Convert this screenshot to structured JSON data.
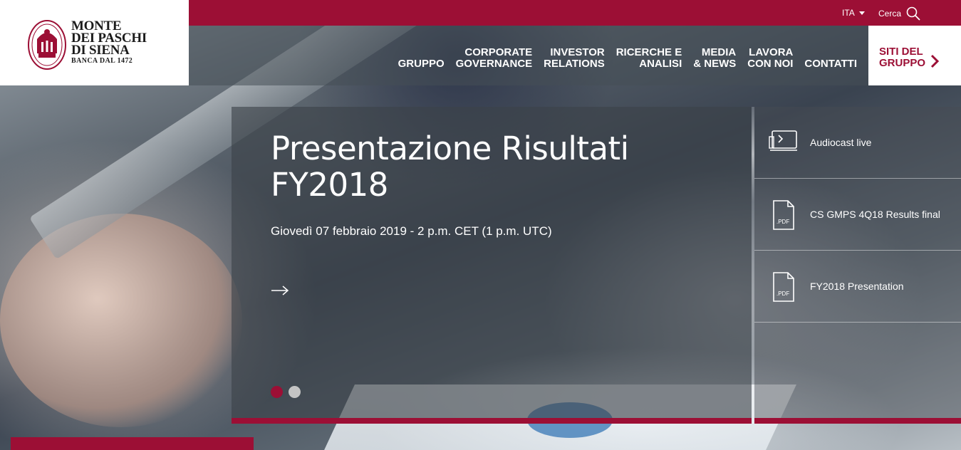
{
  "brand": {
    "name_lines": [
      "MONTE",
      "DEI PASCHI",
      "DI SIENA"
    ],
    "tagline": "BANCA DAL 1472"
  },
  "topbar": {
    "language": "ITA",
    "search_label": "Cerca"
  },
  "nav": {
    "items": [
      {
        "label": "GRUPPO"
      },
      {
        "label": "CORPORATE\nGOVERNANCE"
      },
      {
        "label": "INVESTOR\nRELATIONS"
      },
      {
        "label": "RICERCHE E\nANALISI"
      },
      {
        "label": "MEDIA\n& NEWS"
      },
      {
        "label": "LAVORA\nCON NOI"
      },
      {
        "label": "CONTATTI"
      }
    ],
    "siti_label": "SITI DEL\nGRUPPO"
  },
  "feature": {
    "title": "Presentazione Risultati FY2018",
    "subtitle": "Giovedì 07 febbraio 2019 - 2 p.m. CET (1 p.m. UTC)",
    "slides_total": 2,
    "active_slide": 1
  },
  "side_links": [
    {
      "label": "Audiocast live",
      "icon": "monitor-play-icon"
    },
    {
      "label": "CS GMPS 4Q18 Results final",
      "icon": "pdf-file-icon",
      "badge": ".PDF"
    },
    {
      "label": "FY2018 Presentation",
      "icon": "pdf-file-icon",
      "badge": ".PDF"
    }
  ],
  "colors": {
    "brand": "#9c0f35",
    "white": "#ffffff"
  }
}
